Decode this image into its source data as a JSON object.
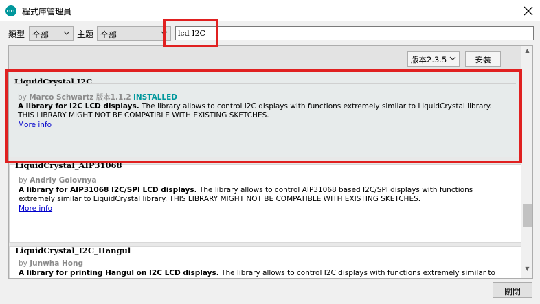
{
  "window": {
    "title": "程式庫管理員"
  },
  "filters": {
    "type_label": "類型",
    "type_value": "全部",
    "topic_label": "主題",
    "topic_value": "全部",
    "search_value": "lcd I2C"
  },
  "toolbar": {
    "version_value": "版本2.3.5",
    "install_label": "安裝"
  },
  "libraries": [
    {
      "name": "LiquidCrystal I2C",
      "by": "by",
      "author": "Marco Schwartz",
      "version_label": "版本",
      "version": "1.1.2",
      "status": "INSTALLED",
      "desc_bold": "A library for I2C LCD displays.",
      "desc_line1_rest": " The library allows to control I2C displays with functions extremely similar to LiquidCrystal library.",
      "desc_line2": "THIS LIBRARY MIGHT NOT BE COMPATIBLE WITH EXISTING SKETCHES.",
      "more": "More info"
    },
    {
      "name": "LiquidCrystal_AIP31068",
      "by": "by",
      "author": "Andriy Golovnya",
      "desc_bold": "A library for AIP31068 I2C/SPI LCD displays.",
      "desc_line1_rest": " The library allows to control AIP31068 based I2C/SPI displays with functions",
      "desc_line2": "extremely similar to LiquidCrystal library. THIS LIBRARY MIGHT NOT BE COMPATIBLE WITH EXISTING SKETCHES.",
      "more": "More info"
    },
    {
      "name": "LiquidCrystal_I2C_Hangul",
      "by": "by",
      "author": "Junwha Hong",
      "desc_bold": "A library for printing Hangul on I2C LCD displays.",
      "desc_line1_rest": " The library allows to control I2C displays with functions extremely similar to"
    }
  ],
  "footer": {
    "close_label": "關閉"
  },
  "colors": {
    "highlight": "#e02020",
    "installed": "#00979c",
    "link": "#0000cc"
  }
}
